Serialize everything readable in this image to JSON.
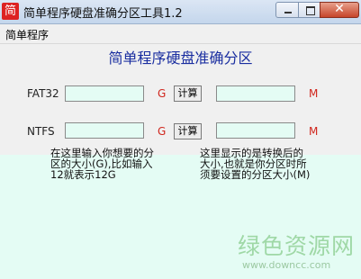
{
  "window": {
    "icon_char": "简",
    "title": "简单程序硬盘准确分区工具1.2",
    "controls": {
      "close": "✕"
    }
  },
  "menu": {
    "items": [
      "简单程序"
    ]
  },
  "main": {
    "heading": "简单程序硬盘准确分区",
    "rows": [
      {
        "label": "FAT32",
        "input_value": "",
        "input_unit": "G",
        "button": "计算",
        "output_value": "",
        "output_unit": "M"
      },
      {
        "label": "NTFS",
        "input_value": "",
        "input_unit": "G",
        "button": "计算",
        "output_value": "",
        "output_unit": "M"
      }
    ],
    "note_left": [
      "在这里输入你想要的分",
      "区的大小(G),比如输入",
      "12就表示12G"
    ],
    "note_right": [
      "这里显示的是转换后的",
      "大小,也就是你分区时所",
      "须要设置的分区大小(M)"
    ]
  },
  "watermark": {
    "text": "绿色资源网",
    "url": "www.downcc.com"
  },
  "colors": {
    "heading": "#1a2ea0",
    "unit": "#d0261d",
    "field_bg": "#e4fcf4"
  }
}
